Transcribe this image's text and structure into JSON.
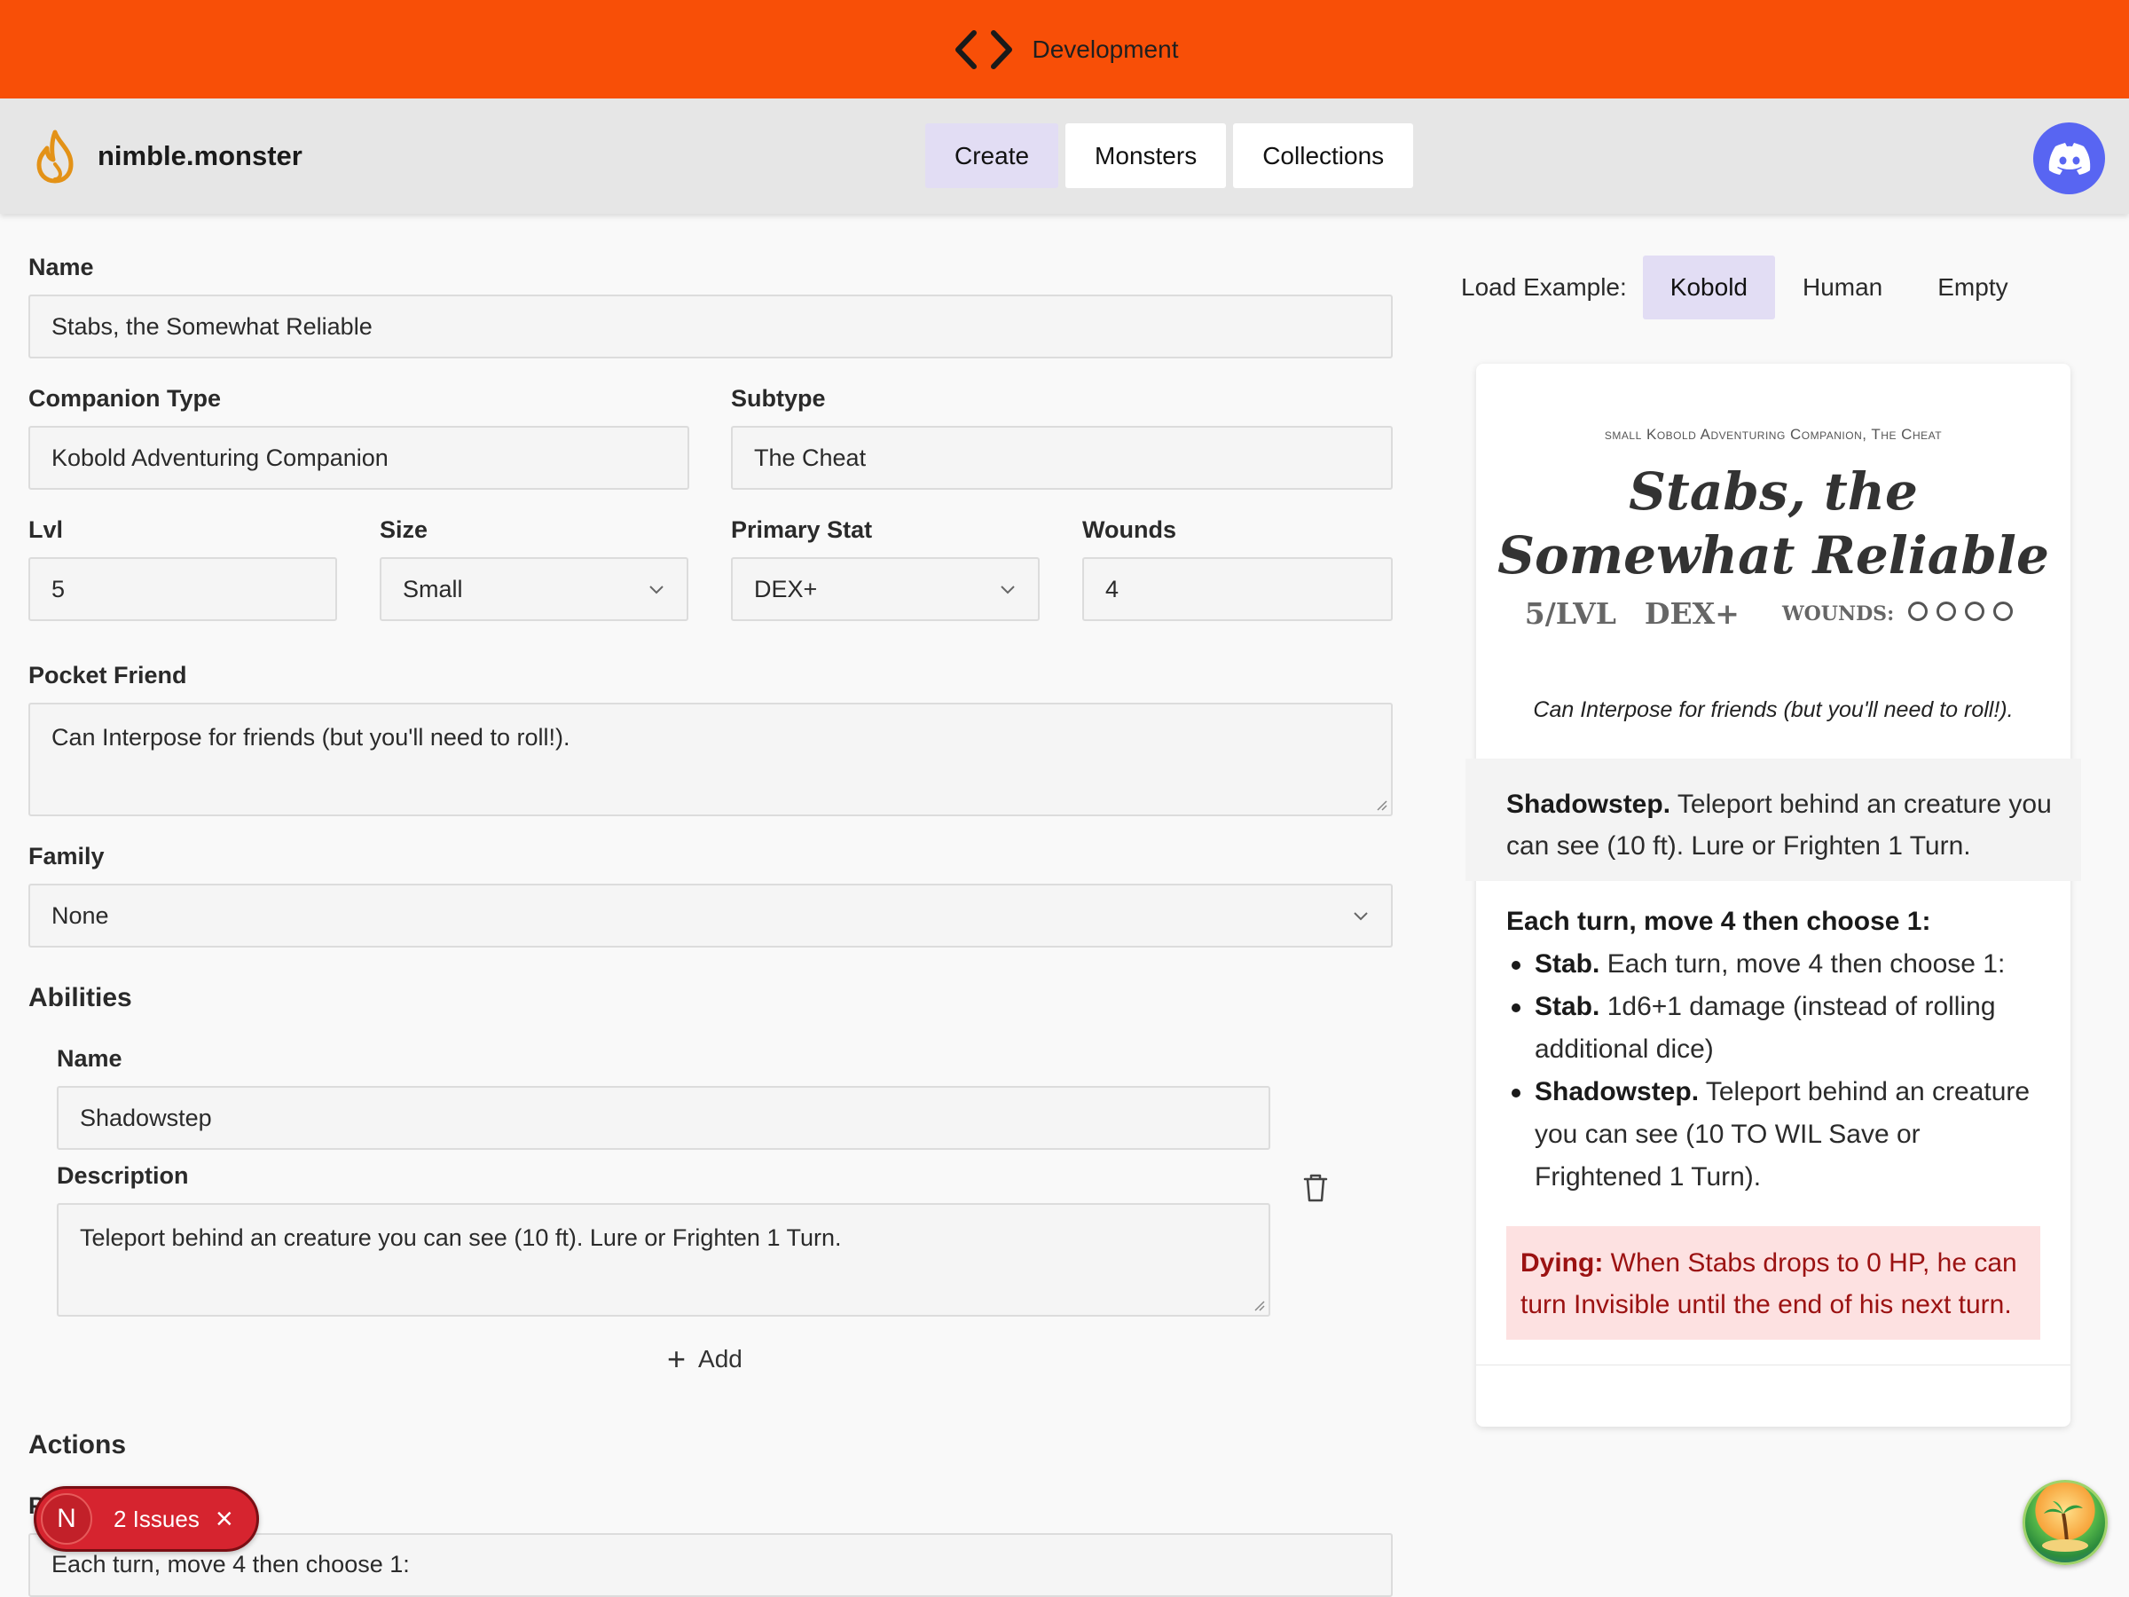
{
  "dev_banner": {
    "label": "Development",
    "icon": "code-brackets-icon"
  },
  "brand": {
    "name": "nimble.monster",
    "icon": "flame-icon"
  },
  "nav": {
    "tabs": [
      {
        "label": "Create",
        "active": true
      },
      {
        "label": "Monsters",
        "active": false
      },
      {
        "label": "Collections",
        "active": false
      }
    ]
  },
  "form": {
    "name_label": "Name",
    "name_value": "Stabs, the Somewhat Reliable",
    "companion_type_label": "Companion Type",
    "companion_type_value": "Kobold Adventuring Companion",
    "subtype_label": "Subtype",
    "subtype_value": "The Cheat",
    "lvl_label": "Lvl",
    "lvl_value": "5",
    "size_label": "Size",
    "size_value": "Small",
    "primary_stat_label": "Primary Stat",
    "primary_stat_value": "DEX+",
    "wounds_label": "Wounds",
    "wounds_value": "4",
    "pocket_friend_label": "Pocket Friend",
    "pocket_friend_value": "Can Interpose for friends (but you'll need to roll!).",
    "family_label": "Family",
    "family_value": "None",
    "abilities_title": "Abilities",
    "ability_name_label": "Name",
    "ability_name_value": "Shadowstep",
    "ability_desc_label": "Description",
    "ability_desc_value": "Teleport behind an creature you can see (10 ft). Lure or Frighten 1 Turn.",
    "add_label": "Add",
    "actions_title": "Actions",
    "actions_partial_label": "P",
    "actions_preamble_value": "Each turn, move 4 then choose 1:"
  },
  "load_example": {
    "label": "Load Example:",
    "options": [
      {
        "label": "Kobold",
        "active": true
      },
      {
        "label": "Human",
        "active": false
      },
      {
        "label": "Empty",
        "active": false
      }
    ]
  },
  "card": {
    "subtitle": "small Kobold Adventuring Companion, The Cheat",
    "title": "Stabs, the Somewhat Reliable",
    "level": "5/LVL",
    "stat": "DEX+",
    "wounds_label": "WOUNDS:",
    "wounds_count": 4,
    "flavor": "Can Interpose for friends (but you'll need to roll!).",
    "ability_name": "Shadowstep.",
    "ability_text": "Teleport behind an creature you can see (10 ft). Lure or Frighten 1 Turn.",
    "actions_preamble": "Each turn, move 4 then choose 1:",
    "actions": [
      {
        "name": "Stab.",
        "text": "Each turn, move 4 then choose 1:"
      },
      {
        "name": "Stab.",
        "text": "1d6+1 damage (instead of rolling additional dice)"
      },
      {
        "name": "Shadowstep.",
        "text": "Teleport behind an creature you can see (10 TO WIL Save or Frightened 1 Turn)."
      }
    ],
    "dying_label": "Dying:",
    "dying_text": "When Stabs drops to 0 HP, he can turn Invisible until the end of his next turn."
  },
  "issues": {
    "initial": "N",
    "count_label": "2 Issues"
  },
  "colors": {
    "banner": "#f84f07",
    "accent": "#e2ddf4",
    "discord": "#5865f2",
    "danger": "#d6242f"
  }
}
